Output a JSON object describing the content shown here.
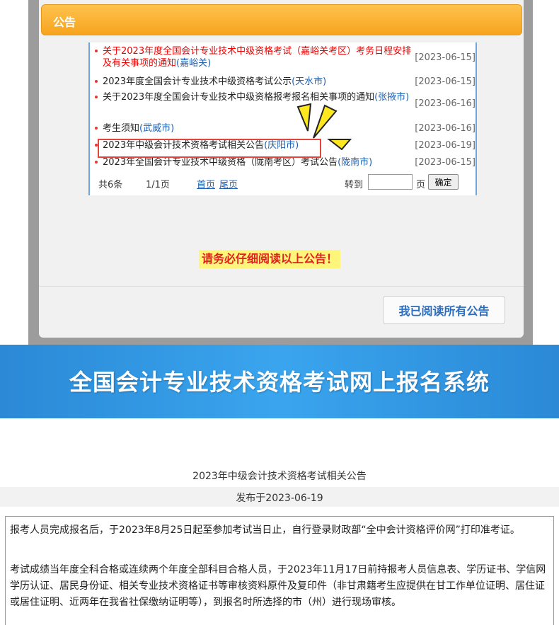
{
  "announcement": {
    "header": "公告",
    "items": [
      {
        "title": "关于2023年度全国会计专业技术中级资格考试（嘉峪关考区）考务日程安排及有关事项的通知",
        "city": "(嘉峪关)",
        "date": "[2023-06-15]",
        "red": true
      },
      {
        "title": "2023年度全国会计专业技术中级资格考试公示",
        "city": "(天水市)",
        "date": "[2023-06-15]",
        "red": false
      },
      {
        "title": "关于2023年度全国会计专业技术中级资格报考报名相关事项的通知",
        "city": "(张掖市)",
        "date": "[2023-06-16]",
        "red": false
      },
      {
        "title": "考生须知",
        "city": "(武威市)",
        "date": "[2023-06-16]",
        "red": false
      },
      {
        "title": "2023年中级会计技术资格考试相关公告",
        "city": "(庆阳市)",
        "date": "[2023-06-19]",
        "red": false
      },
      {
        "title": "2023年全国会计专业技术中级资格（陇南考区）考试公告",
        "city": "(陇南市)",
        "date": "[2023-06-15]",
        "red": false
      }
    ],
    "pager": {
      "total": "共6条",
      "pages": "1/1页",
      "first": "首页",
      "last": "尾页",
      "goto": "转到",
      "page_unit": "页",
      "confirm": "确定",
      "page_input_value": ""
    },
    "notice": "请务必仔细阅读以上公告！",
    "read_all_button": "我已阅读所有公告"
  },
  "banner": {
    "title": "全国会计专业技术资格考试网上报名系统"
  },
  "article": {
    "title": "2023年中级会计技术资格考试相关公告",
    "published": "发布于2023-06-19",
    "paragraphs": [
      "报考人员完成报名后，于2023年8月25日起至参加考试当日止，自行登录财政部“全中会计资格评价网”打印准考证。",
      "考试成绩当年度全科合格或连续两个年度全部科目合格人员，于2023年11月17日前持报考人员信息表、学历证书、学信网学历认证、居民身份证、相关专业技术资格证书等审核资料原件及复印件（非甘肃籍考生应提供在甘工作单位证明、居住证或居住证明、近两年在我省社保缴纳证明等），到报名时所选择的市（州）进行现场审核。"
    ]
  },
  "colors": {
    "header_orange": "#f6a41d",
    "link_blue": "#1d5fb0",
    "alert_red": "#e00000",
    "highlight_yellow": "#fff57a",
    "banner_blue": "#2b89d6"
  }
}
